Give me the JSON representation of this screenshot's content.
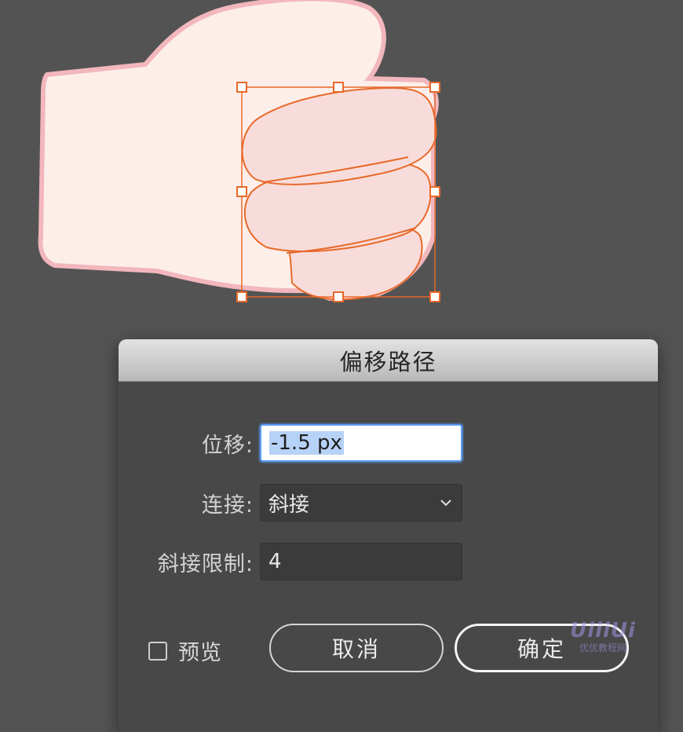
{
  "dialog": {
    "title": "偏移路径",
    "offset": {
      "label": "位移:",
      "value": "-1.5 px"
    },
    "joins": {
      "label": "连接:",
      "value": "斜接"
    },
    "miter_limit": {
      "label": "斜接限制:",
      "value": "4"
    },
    "preview": {
      "label": "预览",
      "checked": false
    },
    "cancel_label": "取消",
    "ok_label": "确定"
  },
  "colors": {
    "background": "#535353",
    "dialog_bg": "#484848",
    "selection": "#e8692a",
    "fist_fill": "#fdeeea",
    "fist_stroke": "#f2b7bd",
    "finger_fill": "#f8dcdb",
    "focus": "#5b9cf5"
  },
  "watermark": {
    "text": "优优教程网"
  }
}
